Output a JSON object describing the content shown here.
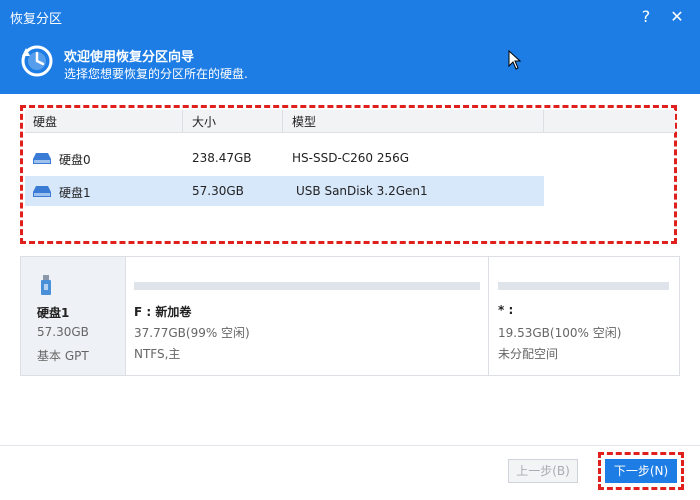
{
  "window": {
    "title": "恢复分区",
    "help_label": "?",
    "close_label": "✕"
  },
  "header": {
    "title": "欢迎使用恢复分区向导",
    "subtitle": "选择您想要恢复的分区所在的硬盘."
  },
  "disk_table": {
    "columns": [
      "硬盘",
      "大小",
      "模型"
    ],
    "rows": [
      {
        "name": "硬盘0",
        "size": "238.47GB",
        "model": "HS-SSD-C260 256G",
        "selected": false
      },
      {
        "name": "硬盘1",
        "size": "57.30GB",
        "model": "USB SanDisk 3.2Gen1",
        "selected": true
      }
    ]
  },
  "disk_detail": {
    "name": "硬盘1",
    "size": "57.30GB",
    "type": "基本 GPT",
    "partitions": [
      {
        "name": "F : 新加卷",
        "size_info": "37.77GB(99% 空闲)",
        "fs_info": "NTFS,主"
      },
      {
        "name": "* :",
        "size_info": "19.53GB(100% 空闲)",
        "fs_info": "未分配空间"
      }
    ]
  },
  "buttons": {
    "prev": "上一步(B)",
    "next": "下一步(N)"
  },
  "colors": {
    "accent": "#1e7de4",
    "highlight_border": "#e0201c",
    "selected_row": "#d8e8fb"
  }
}
